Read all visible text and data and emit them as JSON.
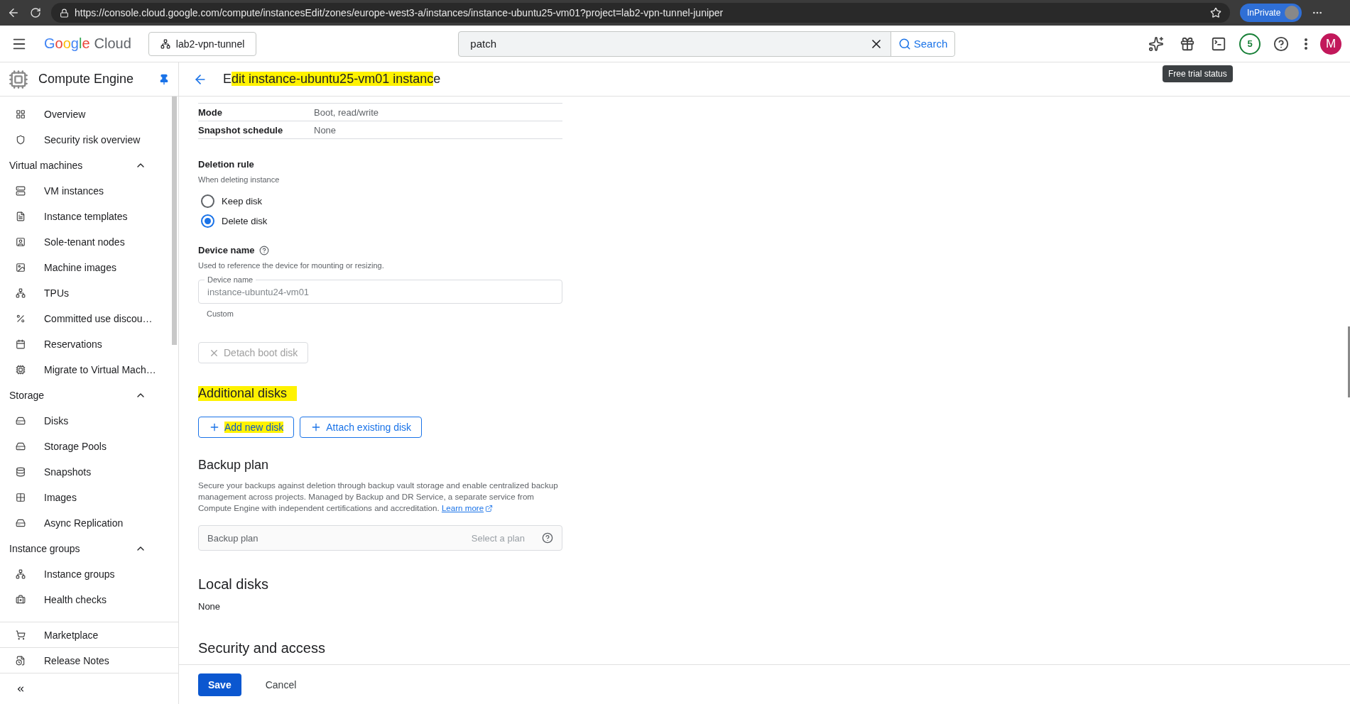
{
  "browser": {
    "url": "https://console.cloud.google.com/compute/instancesEdit/zones/europe-west3-a/instances/instance-ubuntu25-vm01?project=lab2-vpn-tunnel-juniper",
    "profile": "InPrivate"
  },
  "header": {
    "brand": "Google",
    "product": "Cloud",
    "project": "lab2-vpn-tunnel",
    "search": {
      "value": "patch",
      "button": "Search"
    },
    "badge": "5",
    "avatar": "M",
    "tooltip": "Free trial status"
  },
  "sidebar": {
    "title": "Compute Engine",
    "pinned": true,
    "sections": [
      {
        "items": [
          {
            "label": "Overview"
          },
          {
            "label": "Security risk overview"
          }
        ]
      },
      {
        "heading": "Virtual machines",
        "expanded": true,
        "items": [
          {
            "label": "VM instances"
          },
          {
            "label": "Instance templates"
          },
          {
            "label": "Sole-tenant nodes"
          },
          {
            "label": "Machine images"
          },
          {
            "label": "TPUs"
          },
          {
            "label": "Committed use discou…"
          },
          {
            "label": "Reservations"
          },
          {
            "label": "Migrate to Virtual Mach…"
          }
        ]
      },
      {
        "heading": "Storage",
        "expanded": true,
        "items": [
          {
            "label": "Disks"
          },
          {
            "label": "Storage Pools"
          },
          {
            "label": "Snapshots"
          },
          {
            "label": "Images"
          },
          {
            "label": "Async Replication"
          }
        ]
      },
      {
        "heading": "Instance groups",
        "expanded": true,
        "items": [
          {
            "label": "Instance groups"
          },
          {
            "label": "Health checks"
          }
        ]
      }
    ],
    "footer_items": [
      {
        "label": "Marketplace"
      },
      {
        "label": "Release Notes"
      }
    ]
  },
  "page": {
    "title": [
      {
        "text": "E",
        "highlighted": false
      },
      {
        "text": "dit instance-ubuntu25-vm01 instanc",
        "highlighted": true
      },
      {
        "text": "e",
        "highlighted": false
      }
    ],
    "disk_rows": [
      {
        "label": "Mode",
        "value": "Boot, read/write"
      },
      {
        "label": "Snapshot schedule",
        "value": "None"
      }
    ],
    "deletion_rule": {
      "heading": "Deletion rule",
      "hint": "When deleting instance",
      "options": [
        {
          "label": "Keep disk",
          "selected": false
        },
        {
          "label": "Delete disk",
          "selected": true
        }
      ]
    },
    "device_name": {
      "heading": "Device name",
      "hint": "Used to reference the device for mounting or resizing.",
      "field_label": "Device name",
      "value": "instance-ubuntu24-vm01",
      "disabled": true,
      "helper": "Custom"
    },
    "detach_button": {
      "label": "Detach boot disk",
      "disabled": true
    },
    "additional_disks": {
      "heading": "Additional disks",
      "highlighted": true,
      "buttons": [
        {
          "label": "Add new disk",
          "highlighted": true
        },
        {
          "label": "Attach existing disk",
          "highlighted": false
        }
      ]
    },
    "backup": {
      "heading": "Backup plan",
      "description": "Secure your backups against deletion through backup vault storage and enable centralized backup management across projects. Managed by Backup and DR Service, a separate service from Compute Engine with independent certifications and accreditation.",
      "link": "Learn more",
      "field_label": "Backup plan",
      "placeholder": "Select a plan"
    },
    "local_disks": {
      "heading": "Local disks",
      "value": "None"
    },
    "security": {
      "heading": "Security and access"
    }
  },
  "footer": {
    "buttons": [
      {
        "label": "Save",
        "kind": "primary"
      },
      {
        "label": "Cancel",
        "kind": "text"
      }
    ]
  }
}
